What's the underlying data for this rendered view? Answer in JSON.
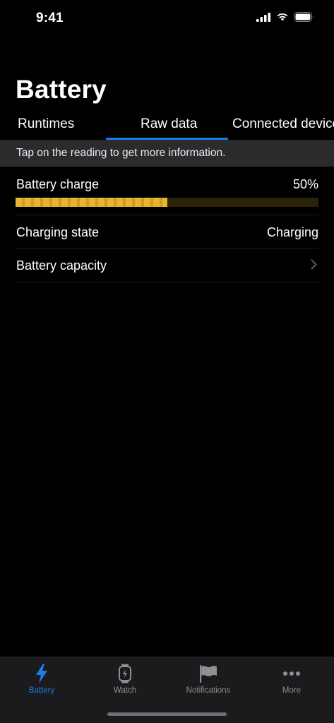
{
  "status_bar": {
    "time": "9:41"
  },
  "page": {
    "title": "Battery"
  },
  "tabs": [
    {
      "label": "Runtimes",
      "active": false
    },
    {
      "label": "Raw data",
      "active": true
    },
    {
      "label": "Connected devices",
      "active": false
    }
  ],
  "info_banner": {
    "text": "Tap on the reading to get more information."
  },
  "rows": {
    "battery_charge": {
      "label": "Battery charge",
      "value": "50%",
      "level": 0.5
    },
    "charging_state": {
      "label": "Charging state",
      "value": "Charging"
    },
    "battery_capacity": {
      "label": "Battery capacity"
    }
  },
  "tab_bar": {
    "items": [
      {
        "label": "Battery",
        "icon": "bolt-icon",
        "active": true
      },
      {
        "label": "Watch",
        "icon": "watch-icon",
        "active": false
      },
      {
        "label": "Notifications",
        "icon": "flag-icon",
        "active": false
      },
      {
        "label": "More",
        "icon": "more-dots-icon",
        "active": false
      }
    ]
  },
  "colors": {
    "accent": "#1a7fe6",
    "charge_bar": "#e6b52a",
    "banner_background": "#2b2b2d",
    "background": "#000000"
  }
}
